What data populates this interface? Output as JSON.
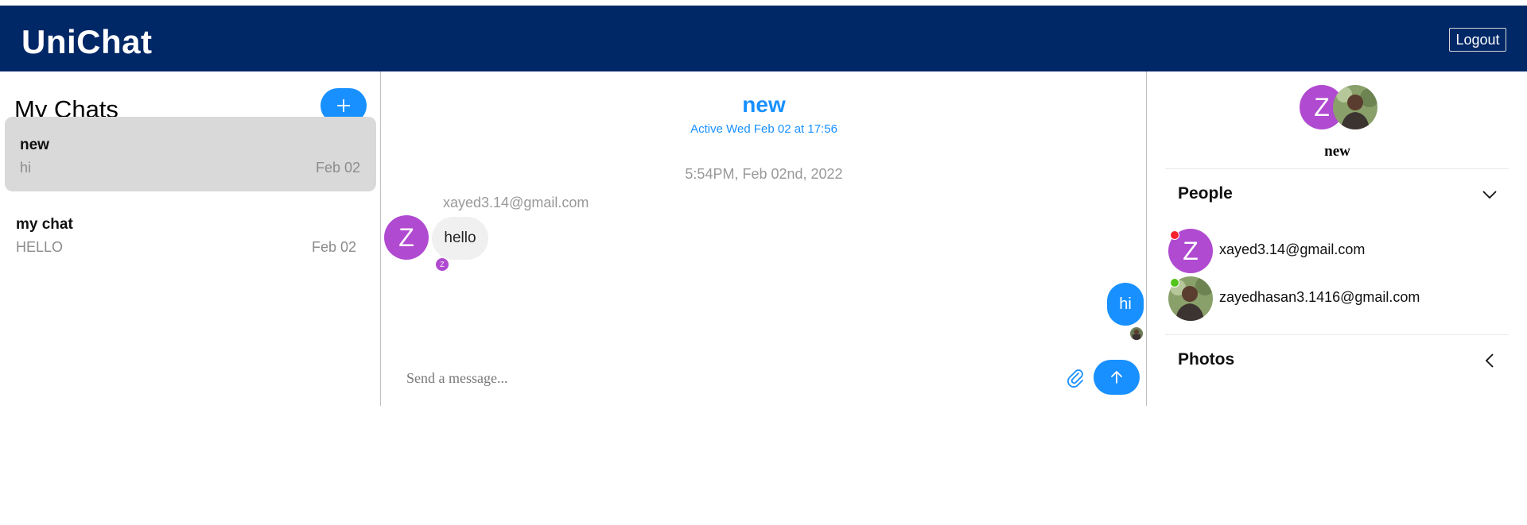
{
  "app": {
    "title": "UniChat",
    "logout_label": "Logout"
  },
  "sidebar": {
    "title": "My Chats",
    "new_chat_icon": "plus-icon",
    "chats": [
      {
        "title": "new",
        "preview": "hi",
        "date": "Feb 02",
        "active": true
      },
      {
        "title": "my chat",
        "preview": "HELLO",
        "date": "Feb 02",
        "active": false
      }
    ]
  },
  "conversation": {
    "title": "new",
    "subtitle": "Active Wed Feb 02 at 17:56",
    "timestamp": "5:54PM, Feb 02nd, 2022",
    "messages": [
      {
        "sender": "xayed3.14@gmail.com",
        "initial": "Z",
        "text": "hello",
        "direction": "incoming",
        "read_initial": "Z"
      },
      {
        "text": "hi",
        "direction": "outgoing"
      }
    ],
    "input": {
      "placeholder": "Send a message...",
      "value": ""
    },
    "attach_icon": "paperclip-icon",
    "send_icon": "arrow-up-icon"
  },
  "details": {
    "avatar_initial": "Z",
    "chat_name": "new",
    "people_section": {
      "title": "People",
      "icon": "chevron-down-icon"
    },
    "people": [
      {
        "initial": "Z",
        "email": "xayed3.14@gmail.com",
        "status": "offline",
        "status_color": "#f5222d"
      },
      {
        "initial": "",
        "email": "zayedhasan3.1416@gmail.com",
        "status": "online",
        "status_color": "#52c41a"
      }
    ],
    "photos_section": {
      "title": "Photos",
      "icon": "chevron-left-icon"
    }
  },
  "colors": {
    "header": "#002766",
    "accent": "#1890ff",
    "avatar": "#b04ad0",
    "active_chat": "#d9d9d9"
  }
}
